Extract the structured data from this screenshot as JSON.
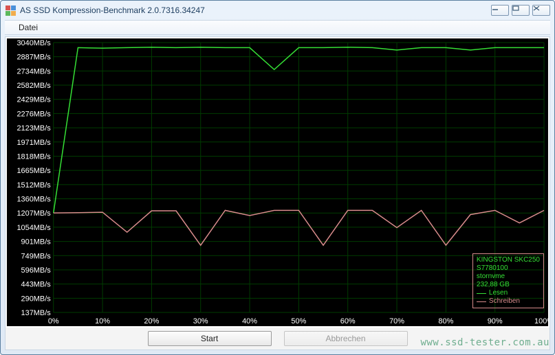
{
  "window": {
    "title": "AS SSD Kompression-Benchmark 2.0.7316.34247"
  },
  "menu": {
    "items": [
      "Datei"
    ]
  },
  "buttons": {
    "start": "Start",
    "cancel": "Abbrechen"
  },
  "legend": {
    "device": "KINGSTON SKC250",
    "firmware": "S7780100",
    "driver": "stornvme",
    "capacity": "232,88 GB",
    "read": "Lesen",
    "write": "Schreiben",
    "read_color": "#35e035",
    "write_color": "#d98c8c"
  },
  "watermark": "www.ssd-tester.com.au",
  "chart_data": {
    "type": "line",
    "xlabel": "",
    "ylabel": "",
    "x_ticks": [
      "0%",
      "10%",
      "20%",
      "30%",
      "40%",
      "50%",
      "60%",
      "70%",
      "80%",
      "90%",
      "100%"
    ],
    "y_ticks": [
      "3040MB/s",
      "2887MB/s",
      "2734MB/s",
      "2582MB/s",
      "2429MB/s",
      "2276MB/s",
      "2123MB/s",
      "1971MB/s",
      "1818MB/s",
      "1665MB/s",
      "1512MB/s",
      "1360MB/s",
      "1207MB/s",
      "1054MB/s",
      "901MB/s",
      "749MB/s",
      "596MB/s",
      "443MB/s",
      "290MB/s",
      "137MB/s"
    ],
    "x_values": [
      0,
      5,
      10,
      15,
      20,
      25,
      30,
      35,
      40,
      45,
      50,
      55,
      60,
      65,
      70,
      75,
      80,
      85,
      90,
      95,
      100
    ],
    "series": [
      {
        "name": "Lesen",
        "color": "#35e035",
        "values": [
          1207,
          2985,
          2980,
          2985,
          2990,
          2985,
          2990,
          2985,
          2985,
          2750,
          2985,
          2985,
          2990,
          2985,
          2960,
          2985,
          2985,
          2960,
          2985,
          2985,
          2985
        ]
      },
      {
        "name": "Schreiben",
        "color": "#d98c8c",
        "values": [
          1207,
          1210,
          1215,
          1000,
          1230,
          1230,
          860,
          1235,
          1180,
          1235,
          1235,
          860,
          1235,
          1235,
          1050,
          1235,
          860,
          1190,
          1235,
          1100,
          1235
        ]
      }
    ],
    "ylim": [
      137,
      3040
    ],
    "xlim": [
      0,
      100
    ]
  }
}
